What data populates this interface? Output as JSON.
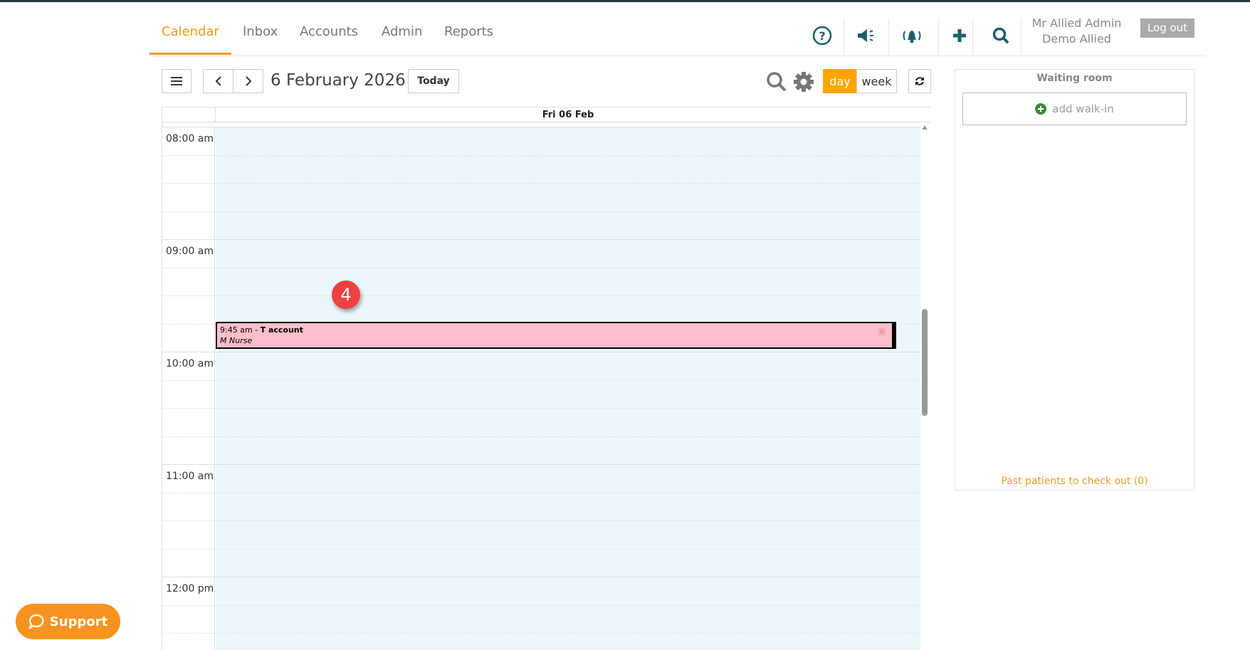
{
  "nav": {
    "tabs": [
      {
        "label": "Calendar"
      },
      {
        "label": "Inbox"
      },
      {
        "label": "Accounts"
      },
      {
        "label": "Admin"
      },
      {
        "label": "Reports"
      }
    ]
  },
  "user": {
    "name": "Mr Allied Admin",
    "org": "Demo Allied",
    "logout": "Log out"
  },
  "toolbar": {
    "date": "6 February 2026",
    "today": "Today",
    "day": "day",
    "week": "week"
  },
  "calendar": {
    "column_header": "Fri 06 Feb",
    "times": [
      "08:00 am",
      "09:00 am",
      "10:00 am",
      "11:00 am",
      "12:00 pm"
    ],
    "event": {
      "time": "9:45 am",
      "title": "T account",
      "separator": " - ",
      "practitioner": "M Nurse"
    }
  },
  "badge": "4",
  "waiting_room": {
    "title": "Waiting room",
    "add": "add walk-in",
    "past": "Past patients to check out (0)"
  },
  "support": "Support",
  "colors": {
    "accent": "#f39a1e",
    "icon": "#1d5f6a",
    "event": "#ffbfcb",
    "slot": "#eaf8fd"
  }
}
